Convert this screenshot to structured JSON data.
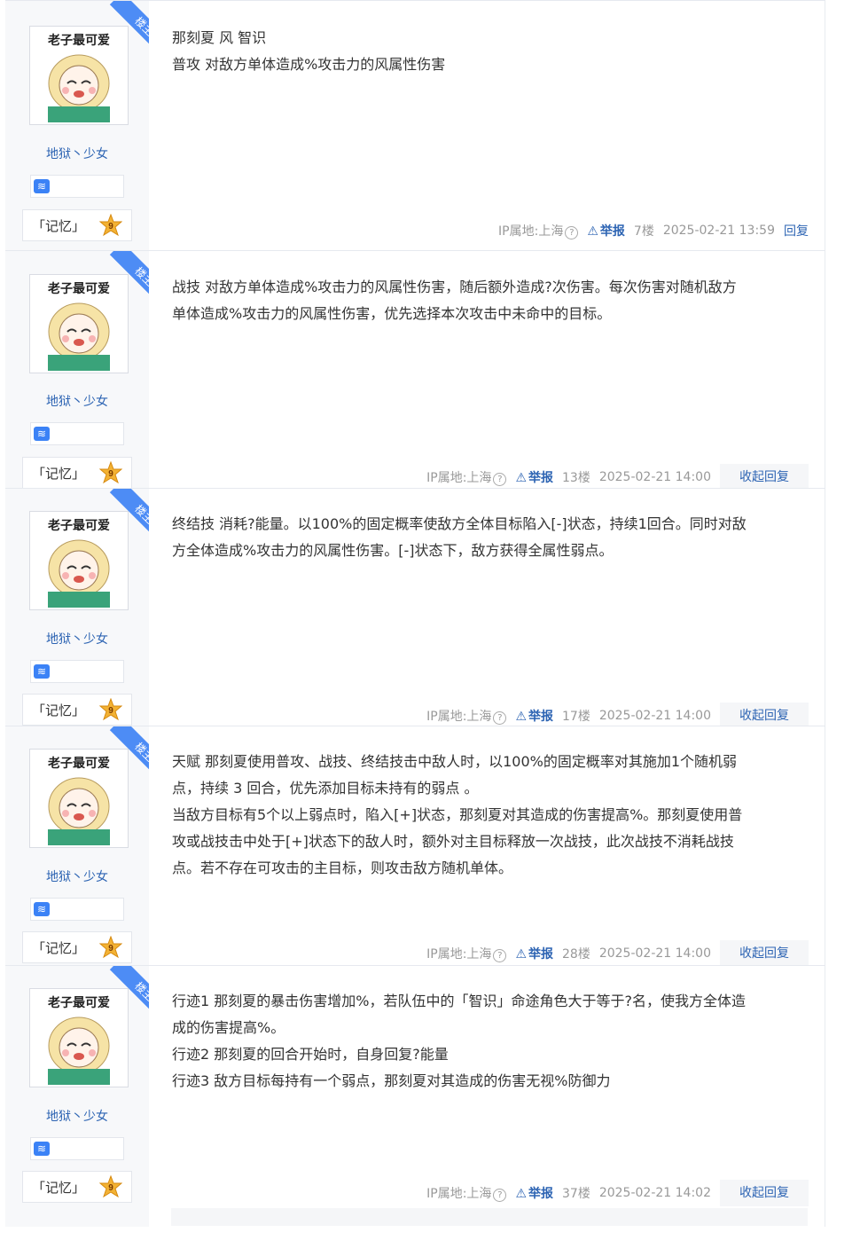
{
  "common": {
    "avatar_text": "老子最可爱",
    "ribbon": "楼主",
    "username": "地狱丶少女",
    "badge_icon": "≋",
    "level_name": "「记忆」",
    "level_num": "9",
    "ip": "IP属地:上海",
    "help": "?",
    "report": "举报",
    "reply": "回复",
    "collapse": "收起回复"
  },
  "posts": [
    {
      "lines": [
        "那刻夏 风 智识",
        "普攻 对敌方单体造成%攻击力的风属性伤害"
      ],
      "floor": "7楼",
      "time": "2025-02-21 13:59"
    },
    {
      "lines": [
        "战技 对敌方单体造成%攻击力的风属性伤害，随后额外造成?次伤害。每次伤害对随机敌方",
        "单体造成%攻击力的风属性伤害，优先选择本次攻击中未命中的目标。"
      ],
      "floor": "13楼",
      "time": "2025-02-21 14:00"
    },
    {
      "lines": [
        "终结技 消耗?能量。以100%的固定概率使敌方全体目标陷入[-]状态，持续1回合。同时对敌",
        "方全体造成%攻击力的风属性伤害。[-]状态下，敌方获得全属性弱点。"
      ],
      "floor": "17楼",
      "time": "2025-02-21 14:00"
    },
    {
      "lines": [
        "天赋 那刻夏使用普攻、战技、终结技击中敌人时，以100%的固定概率对其施加1个随机弱",
        "点，持续 3 回合，优先添加目标未持有的弱点 。",
        "当敌方目标有5个以上弱点时，陷入[+]状态，那刻夏对其造成的伤害提高%。那刻夏使用普",
        "攻或战技击中处于[+]状态下的敌人时，额外对主目标释放一次战技，此次战技不消耗战技",
        "点。若不存在可攻击的主目标，则攻击敌方随机单体。"
      ],
      "floor": "28楼",
      "time": "2025-02-21 14:00"
    },
    {
      "lines": [
        "行迹1 那刻夏的暴击伤害增加%，若队伍中的「智识」命途角色大于等于?名，使我方全体造",
        "成的伤害提高%。",
        "行迹2 那刻夏的回合开始时，自身回复?能量",
        "行迹3 敌方目标每持有一个弱点，那刻夏对其造成的伤害无视%防御力"
      ],
      "floor": "37楼",
      "time": "2025-02-21 14:02"
    }
  ],
  "colors": {
    "accent": "#2d64b3",
    "ribbon": "#4d8cf5",
    "sidebar": "#f7f8fa",
    "meta": "#999999"
  }
}
